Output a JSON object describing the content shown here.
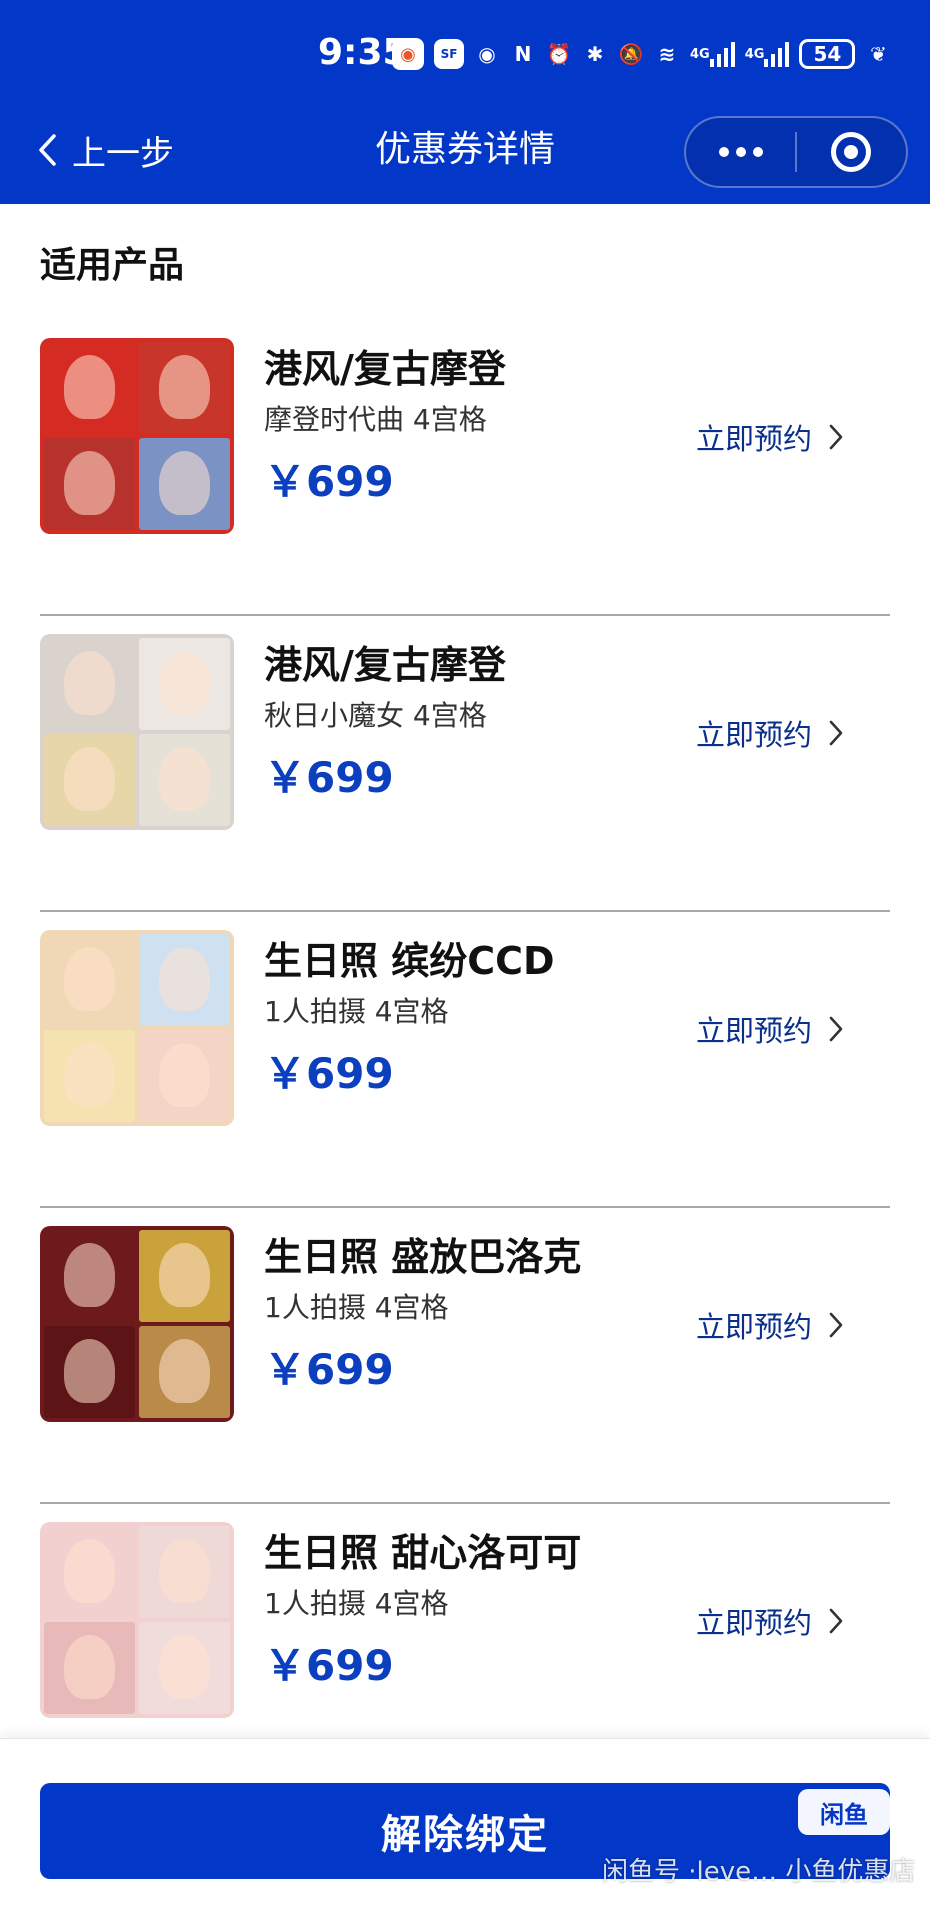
{
  "status_bar": {
    "time": "9:35",
    "icons": [
      "weibo-icon",
      "sf-icon",
      "eye-icon",
      "nfc-icon",
      "alarm-icon",
      "bluetooth-icon",
      "mute-icon",
      "wifi-icon",
      "4g-signal-icon",
      "4g-signal-icon",
      "battery-icon",
      "leaf-icon"
    ],
    "weibo_glyph": "◉",
    "sf_label": "SF",
    "eye_glyph": "◉",
    "nfc_label": "N",
    "alarm_glyph": "⏰",
    "bluetooth_glyph": "✱",
    "mute_glyph": "🔕",
    "wifi_glyph": "≋",
    "network_label_1": "4G",
    "network_label_2": "4G",
    "battery": "54",
    "leaf_glyph": "❦"
  },
  "nav": {
    "back_label": "上一步",
    "title": "优惠券详情"
  },
  "section_title": "适用产品",
  "products": [
    {
      "name": "港风/复古摩登",
      "desc": "摩登时代曲 4宫格",
      "price": "￥699",
      "action": "立即预约",
      "colors": [
        "#d42b22",
        "#c8352b",
        "#b8322d",
        "#7b92c4"
      ]
    },
    {
      "name": "港风/复古摩登",
      "desc": "秋日小魔女 4宫格",
      "price": "￥699",
      "action": "立即预约",
      "colors": [
        "#d9d2cd",
        "#ece7e2",
        "#e7d6a8",
        "#e6e1d6"
      ]
    },
    {
      "name": "生日照 缤纷CCD",
      "desc": "1人拍摄 4宫格",
      "price": "￥699",
      "action": "立即预约",
      "colors": [
        "#f0d7b6",
        "#cfe0f0",
        "#f4e2b0",
        "#f3d4c6"
      ]
    },
    {
      "name": "生日照 盛放巴洛克",
      "desc": "1人拍摄 4宫格",
      "price": "￥699",
      "action": "立即预约",
      "colors": [
        "#6e1a1c",
        "#c9a23b",
        "#5c1416",
        "#b98a48"
      ]
    },
    {
      "name": "生日照 甜心洛可可",
      "desc": "1人拍摄 4宫格",
      "price": "￥699",
      "action": "立即预约",
      "colors": [
        "#f3d0d0",
        "#efd9d6",
        "#e8b9b9",
        "#f1dcdc"
      ]
    }
  ],
  "bottom": {
    "button_label": "解除绑定"
  },
  "watermark": {
    "logo_text": "闲鱼",
    "text": "闲鱼号 ·leve… 小鱼优惠店"
  },
  "colors": {
    "brand_blue": "#0337c7",
    "price_blue": "#0b3fbf",
    "action_blue": "#0a2f8c"
  }
}
